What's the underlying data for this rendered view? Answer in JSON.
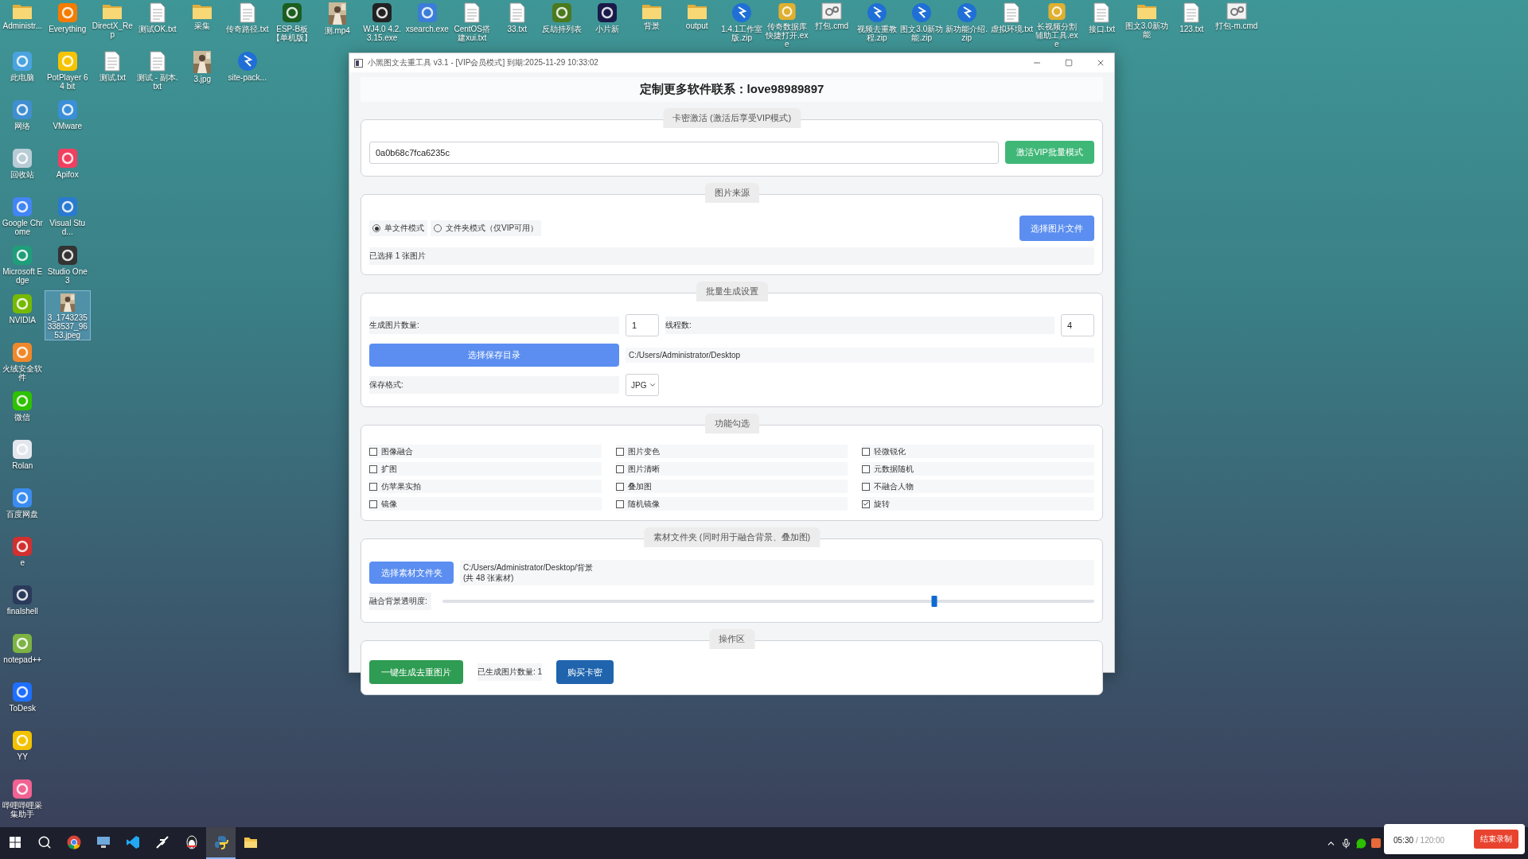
{
  "desktop": {
    "columns": [
      [
        {
          "label": "Administr...",
          "kind": "folder",
          "selected": false
        },
        {
          "label": "此电脑",
          "kind": "app",
          "color": "#4aa3df",
          "selected": false
        },
        {
          "label": "网络",
          "kind": "app",
          "color": "#3f8fd0",
          "selected": false
        },
        {
          "label": "回收站",
          "kind": "app",
          "color": "#b8ccd6",
          "selected": false
        },
        {
          "label": "Google Chrome",
          "kind": "app",
          "color": "#4285f4",
          "selected": false
        },
        {
          "label": "Microsoft Edge",
          "kind": "app",
          "color": "#1e9e7a",
          "selected": false
        },
        {
          "label": "NVIDIA",
          "kind": "app",
          "color": "#76b900",
          "selected": false
        },
        {
          "label": "火绒安全软件",
          "kind": "app",
          "color": "#f0882b",
          "selected": false
        },
        {
          "label": "微信",
          "kind": "app",
          "color": "#2dc100",
          "selected": false
        },
        {
          "label": "Rolan",
          "kind": "app",
          "color": "#e4e6ee",
          "selected": false
        },
        {
          "label": "百度网盘",
          "kind": "app",
          "color": "#3b8cf0",
          "selected": false
        },
        {
          "label": "e",
          "kind": "app",
          "color": "#d32f2f",
          "selected": false
        },
        {
          "label": "finalshell",
          "kind": "app",
          "color": "#2a3a5a",
          "selected": false
        },
        {
          "label": "notepad++",
          "kind": "app",
          "color": "#7cb342",
          "selected": false
        },
        {
          "label": "ToDesk",
          "kind": "app",
          "color": "#1e6fff",
          "selected": false
        },
        {
          "label": "YY",
          "kind": "app",
          "color": "#f2c200",
          "selected": false
        },
        {
          "label": "哔哩哔哩采集助手",
          "kind": "app",
          "color": "#f06292",
          "selected": false
        }
      ],
      [
        {
          "label": "Everything",
          "kind": "app",
          "color": "#f57c00",
          "selected": false
        },
        {
          "label": "PotPlayer 64 bit",
          "kind": "app",
          "color": "#f5c400",
          "selected": false
        },
        {
          "label": "VMware",
          "kind": "app",
          "color": "#3a8fd8",
          "selected": false
        },
        {
          "label": "Apifox",
          "kind": "app",
          "color": "#f04060",
          "selected": false
        },
        {
          "label": "Visual Stud...",
          "kind": "app",
          "color": "#2a7ad0",
          "selected": false
        },
        {
          "label": "Studio One 3",
          "kind": "app",
          "color": "#333333",
          "selected": false
        },
        {
          "label": "3_1743235338537_9653.jpeg",
          "selected": true
        }
      ],
      [
        {
          "label": "DirectX_Rep",
          "kind": "folder",
          "selected": false
        },
        {
          "label": "测试.txt",
          "kind": "text",
          "selected": false
        }
      ],
      [
        {
          "label": "测试OK.txt",
          "kind": "text",
          "selected": false
        },
        {
          "label": "测试 - 副本.txt",
          "kind": "text",
          "selected": false
        }
      ],
      [
        {
          "label": "采集",
          "kind": "folder",
          "selected": false
        },
        {
          "label": "3.jpg",
          "selected": false
        }
      ],
      [
        {
          "label": "传奇路径.txt",
          "kind": "text",
          "selected": false
        },
        {
          "label": "site-pack...",
          "kind": "zip",
          "selected": false
        }
      ],
      [
        {
          "label": "ESP-B板【单机版】",
          "kind": "app",
          "color": "#1b5e20",
          "selected": false
        }
      ],
      [
        {
          "label": "测.mp4",
          "selected": false
        }
      ],
      [
        {
          "label": "WJ4.0 4.2.3.15.exe",
          "kind": "app",
          "color": "#222222",
          "selected": false
        }
      ],
      [
        {
          "label": "xsearch.exe",
          "kind": "app",
          "color": "#3b7dd8",
          "selected": false
        }
      ],
      [
        {
          "label": "CentOS搭建xui.txt",
          "kind": "text",
          "selected": false
        }
      ],
      [
        {
          "label": "33.txt",
          "kind": "text",
          "selected": false
        }
      ],
      [
        {
          "label": "反劫持列表",
          "kind": "app",
          "color": "#4a7a1e",
          "selected": false
        }
      ],
      [
        {
          "label": "小片新",
          "kind": "app",
          "color": "#1a1a4a",
          "selected": false
        }
      ],
      [
        {
          "label": "背景",
          "kind": "folder",
          "selected": false
        }
      ],
      [
        {
          "label": "output",
          "kind": "folder",
          "selected": false
        }
      ],
      [
        {
          "label": "1.4.1工作室版.zip",
          "kind": "zip",
          "selected": false
        }
      ],
      [
        {
          "label": "传奇数据库快捷打开.exe",
          "kind": "app",
          "color": "#e0b030",
          "selected": false
        }
      ],
      [
        {
          "label": "打包.cmd",
          "kind": "script",
          "selected": false
        }
      ],
      [
        {
          "label": "视频去重教程.zip",
          "kind": "zip",
          "selected": false
        }
      ],
      [
        {
          "label": "图文3.0新功能.zip",
          "kind": "zip",
          "selected": false
        }
      ],
      [
        {
          "label": "新功能介绍.zip",
          "kind": "zip",
          "selected": false
        }
      ],
      [
        {
          "label": "虚拟环境.txt",
          "kind": "text",
          "selected": false
        }
      ],
      [
        {
          "label": "长视频分割辅助工具.exe",
          "kind": "app",
          "color": "#e0b030",
          "selected": false
        }
      ],
      [
        {
          "label": "接口.txt",
          "kind": "text",
          "selected": false
        }
      ],
      [
        {
          "label": "图文3.0新功能",
          "kind": "folder",
          "selected": false
        }
      ],
      [
        {
          "label": "123.txt",
          "kind": "text",
          "selected": false
        }
      ],
      [
        {
          "label": "打包-m.cmd",
          "kind": "script",
          "selected": false
        }
      ]
    ]
  },
  "window": {
    "title": "小黑图文去重工具 v3.1 - [VIP会员模式] 到期:2025-11-29 10:33:02",
    "header": "定制更多软件联系：love98989897",
    "activation": {
      "title": "卡密激活 (激活后享受VIP模式)",
      "value": "0a0b68c7fca6235c",
      "button": "激活VIP批量模式"
    },
    "source": {
      "title": "图片来源",
      "modes": [
        {
          "label": "单文件模式",
          "selected": true
        },
        {
          "label": "文件夹模式（仅VIP可用）",
          "selected": false
        }
      ],
      "button": "选择图片文件",
      "status": "已选择 1 张图片"
    },
    "batch": {
      "title": "批量生成设置",
      "count_label": "生成图片数量:",
      "count": "1",
      "threads_label": "线程数:",
      "threads": "4",
      "dir_button": "选择保存目录",
      "dir": "C:/Users/Administrator/Desktop",
      "format_label": "保存格式:",
      "format": "JPG"
    },
    "features": {
      "title": "功能勾选",
      "options": [
        {
          "label": "图像融合",
          "checked": false
        },
        {
          "label": "图片变色",
          "checked": false
        },
        {
          "label": "轻微锐化",
          "checked": false
        },
        {
          "label": "扩图",
          "checked": false
        },
        {
          "label": "图片清晰",
          "checked": false
        },
        {
          "label": "元数据随机",
          "checked": false
        },
        {
          "label": "仿苹果实拍",
          "checked": false
        },
        {
          "label": "叠加图",
          "checked": false
        },
        {
          "label": "不融合人物",
          "checked": false
        },
        {
          "label": "镜像",
          "checked": false
        },
        {
          "label": "随机镜像",
          "checked": false
        },
        {
          "label": "旋转",
          "checked": true
        }
      ]
    },
    "materials": {
      "title": "素材文件夹 (同时用于融合背景、叠加图)",
      "button": "选择素材文件夹",
      "path": "C:/Users/Administrator/Desktop/背景",
      "count": "(共 48 张素材)",
      "opacity_label": "融合背景透明度:",
      "level": 0.755
    },
    "actions": {
      "title": "操作区",
      "generate": "一键生成去重图片",
      "generated": "已生成图片数量: 1",
      "buy": "购买卡密"
    }
  },
  "taskbar": {
    "apps": [
      {
        "kind": "start",
        "selected": false
      },
      {
        "kind": "search",
        "selected": false
      },
      {
        "kind": "browser",
        "selected": false
      },
      {
        "kind": "monitor",
        "selected": false
      },
      {
        "kind": "code",
        "selected": false
      },
      {
        "kind": "feather",
        "selected": false
      },
      {
        "kind": "penguin",
        "selected": false
      },
      {
        "kind": "snake",
        "selected": true
      },
      {
        "kind": "folder",
        "selected": false
      }
    ],
    "tray": [
      {
        "kind": "chevron"
      },
      {
        "kind": "mic"
      },
      {
        "kind": "chat"
      },
      {
        "kind": "app"
      }
    ]
  },
  "recorder": {
    "elapsed": "05:30",
    "total": "/ 120:00",
    "button": "结束录制"
  }
}
